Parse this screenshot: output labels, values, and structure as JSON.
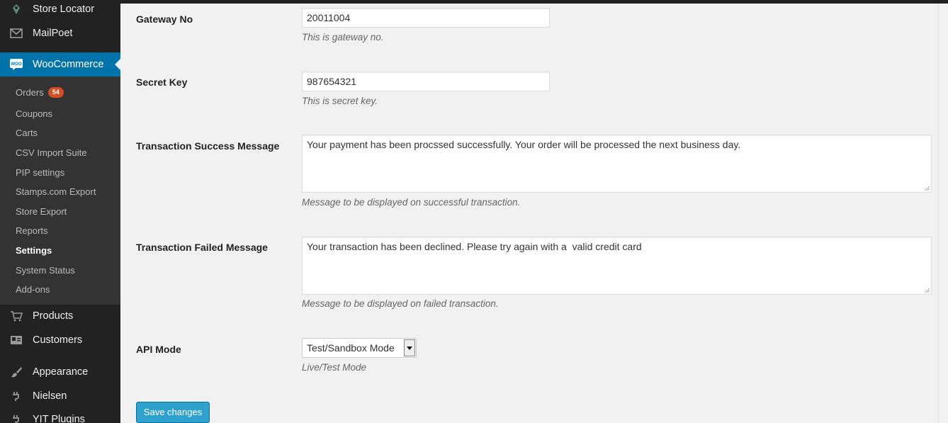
{
  "sidebar": {
    "top_items": [
      {
        "label": "Store Locator",
        "icon": "store-locator-icon"
      },
      {
        "label": "MailPoet",
        "icon": "mail-icon"
      },
      {
        "label": "WooCommerce",
        "icon": "woocommerce-icon"
      }
    ],
    "orders_count": "54",
    "submenu": [
      "Orders",
      "Coupons",
      "Carts",
      "CSV Import Suite",
      "PIP settings",
      "Stamps.com Export",
      "Store Export",
      "Reports",
      "Settings",
      "System Status",
      "Add-ons"
    ],
    "bottom_items": [
      {
        "label": "Products",
        "icon": "cart-icon"
      },
      {
        "label": "Customers",
        "icon": "id-card-icon"
      },
      {
        "label": "Appearance",
        "icon": "paintbrush-icon"
      },
      {
        "label": "Nielsen",
        "icon": "plugin-icon"
      },
      {
        "label": "YIT Plugins",
        "icon": "plugin-icon"
      }
    ],
    "accent_color": "#0073aa",
    "badge_color": "#d54e21"
  },
  "form": {
    "gateway_no": {
      "label": "Gateway No",
      "value": "20011004",
      "description": "This is gateway no."
    },
    "secret_key": {
      "label": "Secret Key",
      "value": "987654321",
      "description": "This is secret key."
    },
    "success_message": {
      "label": "Transaction Success Message",
      "value": "Your payment has been procssed successfully. Your order will be processed the next business day.",
      "description": "Message to be displayed on successful transaction."
    },
    "failed_message": {
      "label": "Transaction Failed Message",
      "value": "Your transaction has been declined. Please try again with a  valid credit card",
      "description": "Message to be displayed on failed transaction."
    },
    "api_mode": {
      "label": "API Mode",
      "value": "Test/Sandbox Mode",
      "description": "Live/Test Mode"
    }
  },
  "save_button": {
    "label": "Save changes",
    "color": "#2ea2cc"
  }
}
